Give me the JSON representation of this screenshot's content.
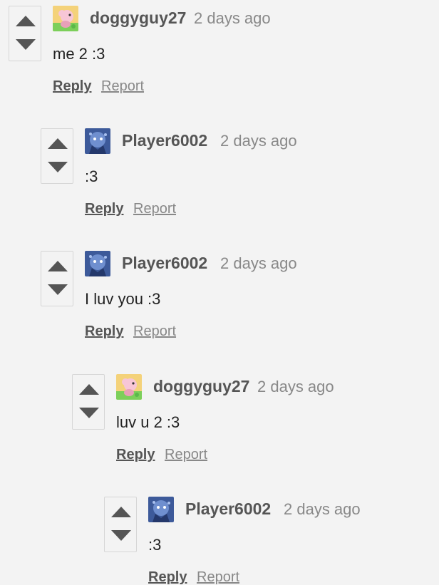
{
  "comments": [
    {
      "author": "doggyguy27",
      "time": "2 days ago",
      "text": "me 2 :3",
      "reply_label": "Reply",
      "report_label": "Report",
      "avatar": "pink-creature-avatar"
    },
    {
      "author": "Player6002",
      "time": "2 days ago",
      "text": ":3",
      "reply_label": "Reply",
      "report_label": "Report",
      "avatar": "blue-character-avatar"
    },
    {
      "author": "Player6002",
      "time": "2 days ago",
      "text": "I luv you :3",
      "reply_label": "Reply",
      "report_label": "Report",
      "avatar": "blue-character-avatar"
    },
    {
      "author": "doggyguy27",
      "time": "2 days ago",
      "text": "luv u 2 :3",
      "reply_label": "Reply",
      "report_label": "Report",
      "avatar": "pink-creature-avatar"
    },
    {
      "author": "Player6002",
      "time": "2 days ago",
      "text": ":3",
      "reply_label": "Reply",
      "report_label": "Report",
      "avatar": "blue-character-avatar"
    }
  ],
  "icons": {
    "upvote": "upvote-arrow-icon",
    "downvote": "downvote-arrow-icon"
  },
  "colors": {
    "background": "#f3f3f3",
    "author": "#555555",
    "muted": "#888888",
    "text": "#222222",
    "arrow": "#555555"
  }
}
